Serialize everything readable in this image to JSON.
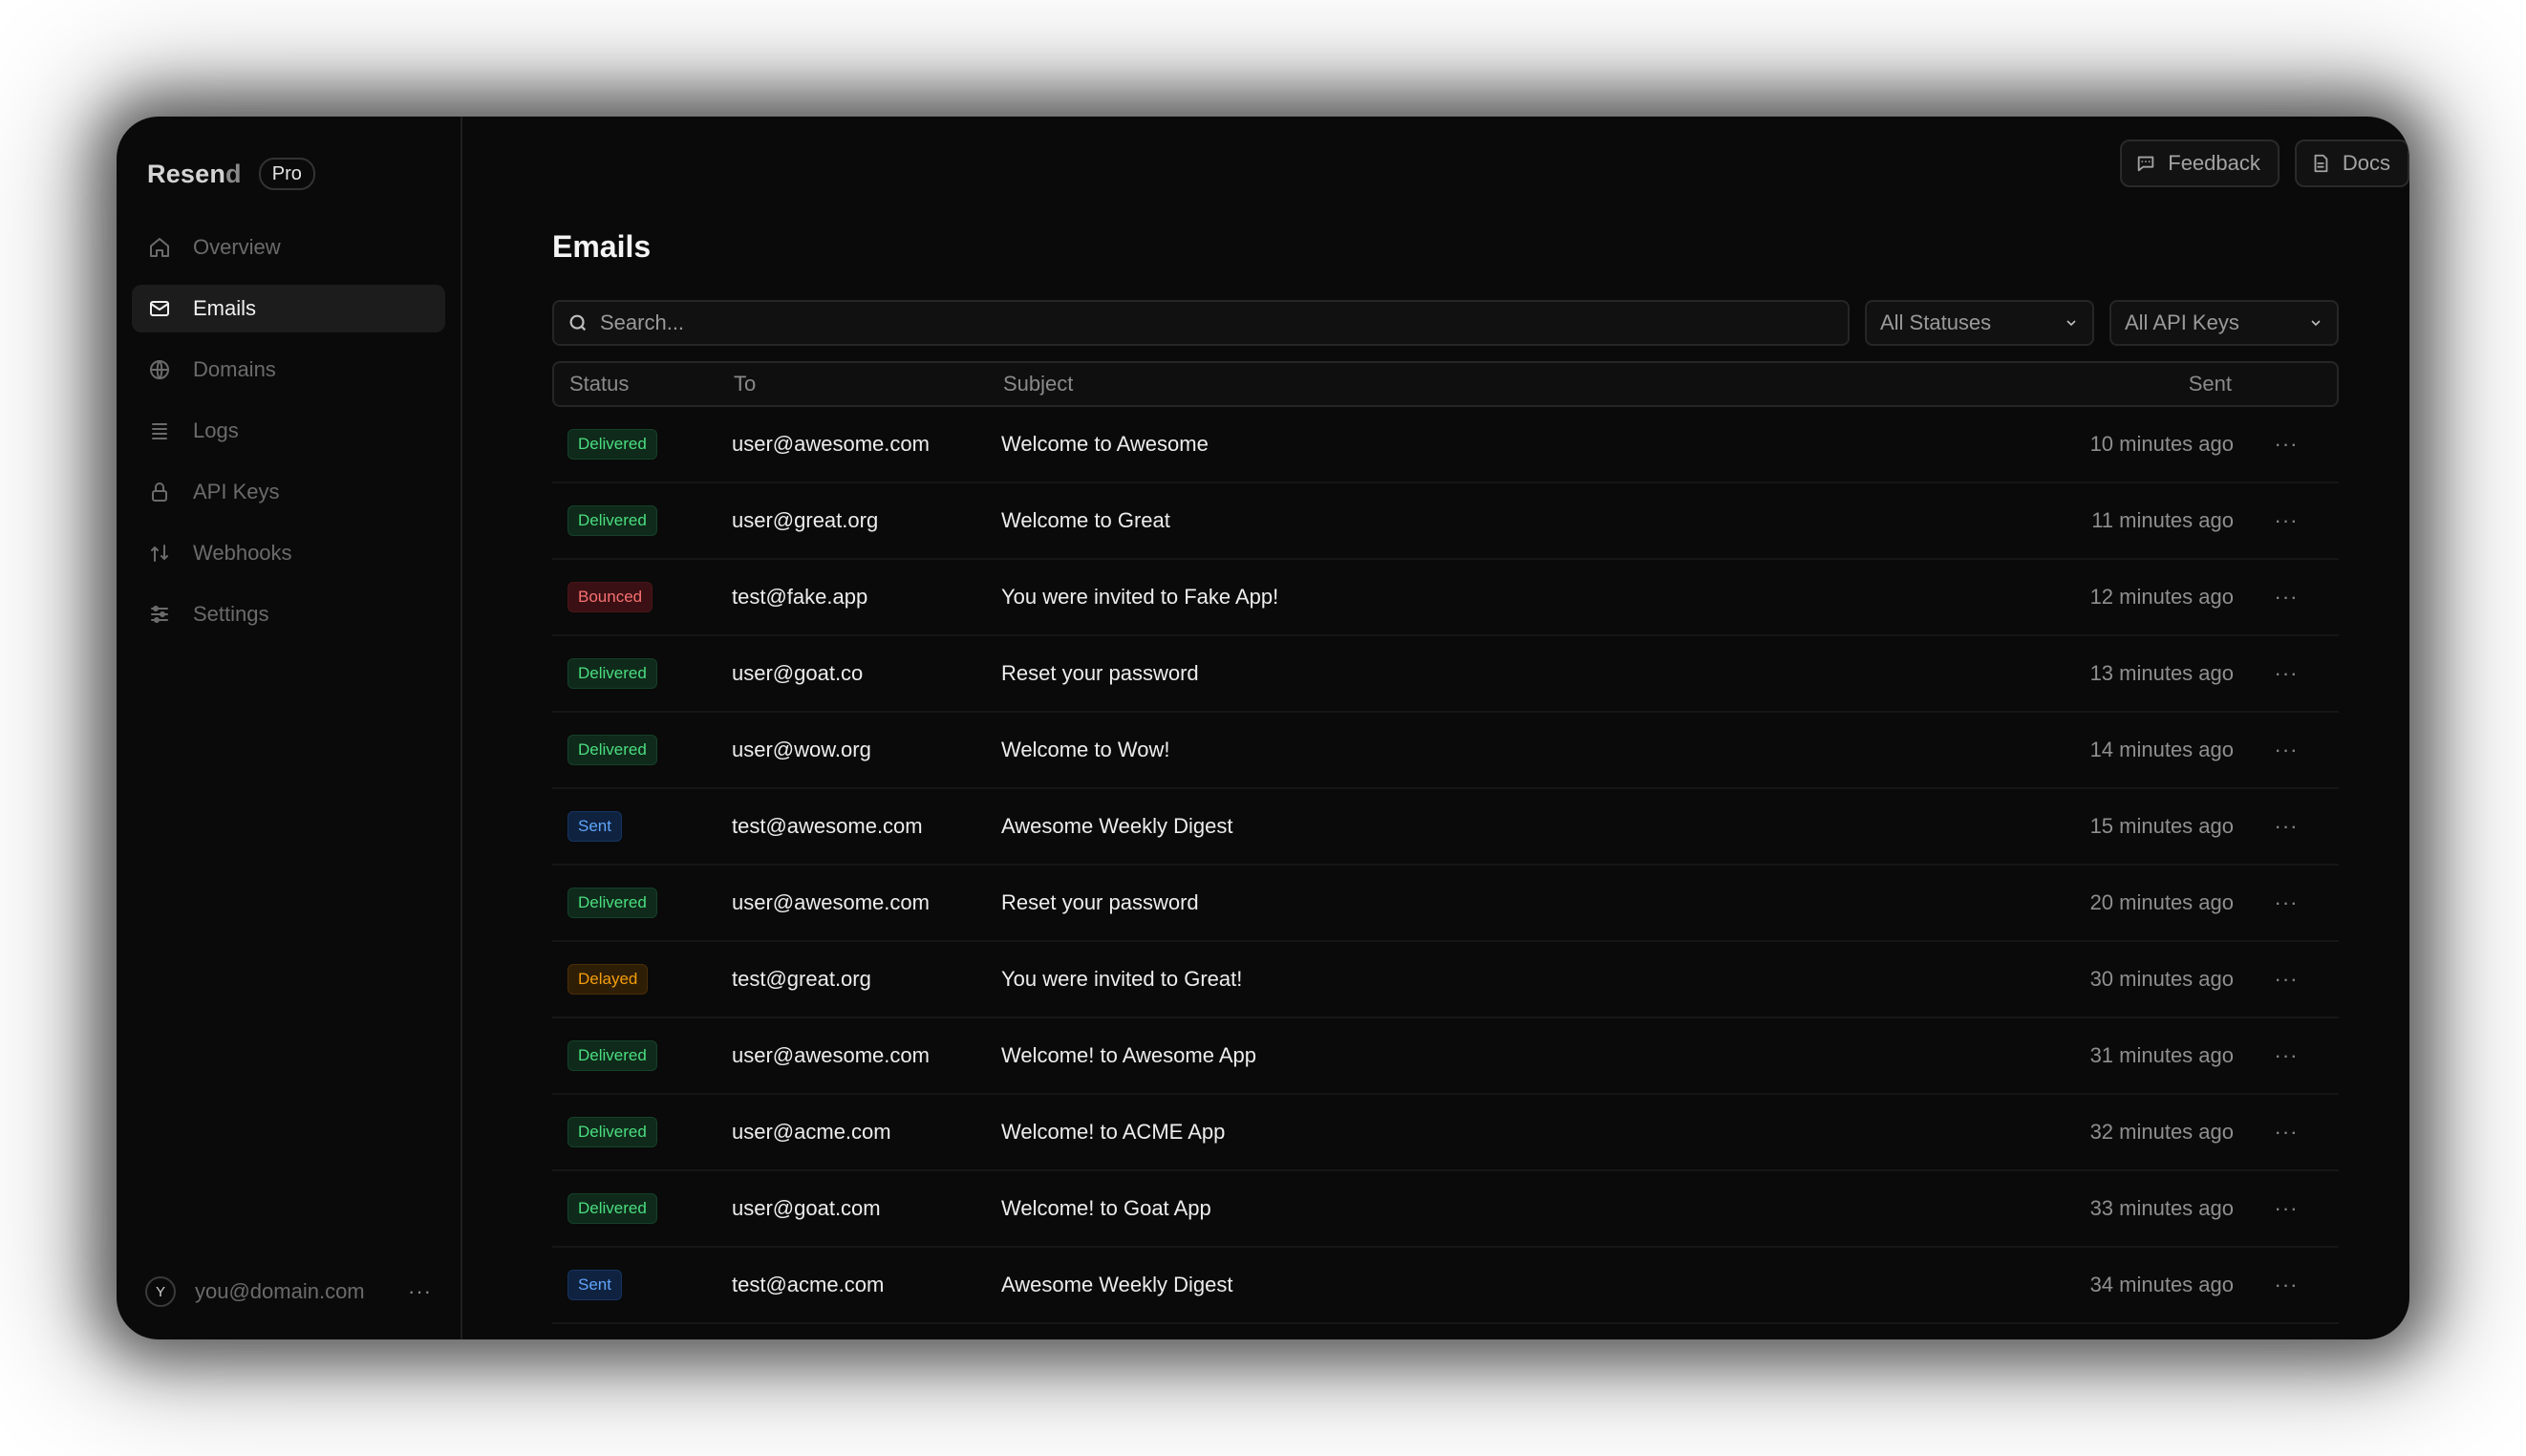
{
  "brand": {
    "name_main": "Resen",
    "name_end": "d",
    "plan": "Pro"
  },
  "nav": [
    {
      "label": "Overview",
      "icon": "home-icon",
      "active": false
    },
    {
      "label": "Emails",
      "icon": "mail-icon",
      "active": true
    },
    {
      "label": "Domains",
      "icon": "globe-icon",
      "active": false
    },
    {
      "label": "Logs",
      "icon": "logs-icon",
      "active": false
    },
    {
      "label": "API Keys",
      "icon": "lock-icon",
      "active": false
    },
    {
      "label": "Webhooks",
      "icon": "webhook-icon",
      "active": false
    },
    {
      "label": "Settings",
      "icon": "sliders-icon",
      "active": false
    }
  ],
  "user": {
    "initial": "Y",
    "email": "you@domain.com",
    "more": "···"
  },
  "header": {
    "feedback_label": "Feedback",
    "docs_label": "Docs"
  },
  "page": {
    "title": "Emails"
  },
  "filters": {
    "search_placeholder": "Search...",
    "status_select": "All Statuses",
    "apikey_select": "All API Keys"
  },
  "table": {
    "columns": {
      "status": "Status",
      "to": "To",
      "subject": "Subject",
      "sent": "Sent"
    },
    "rows": [
      {
        "status": "Delivered",
        "to": "user@awesome.com",
        "subject": "Welcome to Awesome",
        "sent": "10 minutes ago"
      },
      {
        "status": "Delivered",
        "to": "user@great.org",
        "subject": "Welcome to Great",
        "sent": "11 minutes ago"
      },
      {
        "status": "Bounced",
        "to": "test@fake.app",
        "subject": "You were invited to Fake App!",
        "sent": "12 minutes ago"
      },
      {
        "status": "Delivered",
        "to": "user@goat.co",
        "subject": "Reset your password",
        "sent": "13 minutes ago"
      },
      {
        "status": "Delivered",
        "to": "user@wow.org",
        "subject": "Welcome to Wow!",
        "sent": "14 minutes ago"
      },
      {
        "status": "Sent",
        "to": "test@awesome.com",
        "subject": "Awesome Weekly Digest",
        "sent": "15 minutes ago"
      },
      {
        "status": "Delivered",
        "to": "user@awesome.com",
        "subject": "Reset your password",
        "sent": "20 minutes ago"
      },
      {
        "status": "Delayed",
        "to": "test@great.org",
        "subject": "You were invited to Great!",
        "sent": "30 minutes ago"
      },
      {
        "status": "Delivered",
        "to": "user@awesome.com",
        "subject": "Welcome! to Awesome App",
        "sent": "31 minutes ago"
      },
      {
        "status": "Delivered",
        "to": "user@acme.com",
        "subject": "Welcome! to ACME App",
        "sent": "32 minutes ago"
      },
      {
        "status": "Delivered",
        "to": "user@goat.com",
        "subject": "Welcome! to Goat App",
        "sent": "33 minutes ago"
      },
      {
        "status": "Sent",
        "to": "test@acme.com",
        "subject": "Awesome Weekly Digest",
        "sent": "34 minutes ago"
      }
    ],
    "row_action": "···"
  },
  "colors": {
    "background": "#0a0a0a",
    "delivered": "#4ade80",
    "bounced": "#f87171",
    "sent": "#60a5fa",
    "delayed": "#f59e0b"
  }
}
